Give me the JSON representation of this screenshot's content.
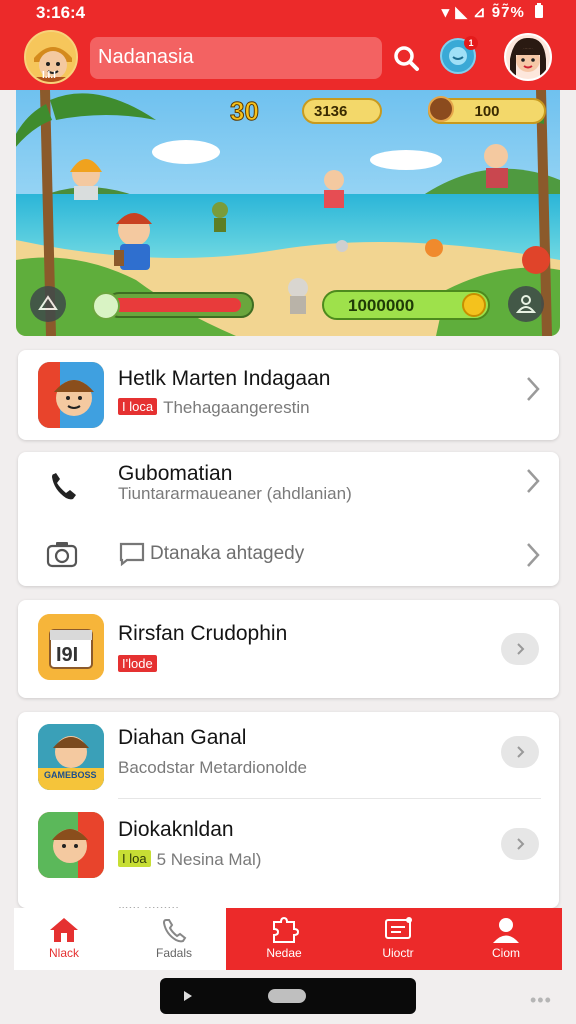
{
  "status": {
    "time": "3:16:4",
    "indicators": "▾ ◣ ⊿ 9̃7̃%",
    "battery_icon": "battery-icon"
  },
  "header": {
    "search_value": "Nadanasia",
    "avatar_label": "I.I.I",
    "notification_count": "1"
  },
  "game": {
    "level": "30",
    "score": "3136",
    "gems": "100",
    "coins": "1000000",
    "health_fraction": 0.92
  },
  "cards": [
    {
      "title": "Hetlk Marten Indagaan",
      "tag": "I loca",
      "subtitle": "Thehagaangerestin"
    },
    {
      "title": "Gubomatian",
      "subtitle": "Tiuntararmaueaner (ahdlanian)",
      "second_label": "Dtanaka ahtagedy"
    },
    {
      "title": "Rirsfan Crudophin",
      "tag": "I'lode",
      "icon_label": "I9I"
    },
    {
      "title": "Diahan Ganal",
      "subtitle": "Bacodstar  Metardionolde",
      "icon_label": "GAMEBOSS"
    },
    {
      "title": "Diokaknldan",
      "tag": "I loa",
      "subtitle": "5 Nesina Mal)"
    },
    {
      "title": "I'IIII IIIIIIIII"
    }
  ],
  "nav": [
    {
      "label": "Nlack",
      "icon": "home-icon"
    },
    {
      "label": "Fadals",
      "icon": "phone-icon"
    },
    {
      "label": "Nedae",
      "icon": "puzzle-icon"
    },
    {
      "label": "Uioctr",
      "icon": "message-icon"
    },
    {
      "label": "Ciom",
      "icon": "person-icon"
    }
  ]
}
